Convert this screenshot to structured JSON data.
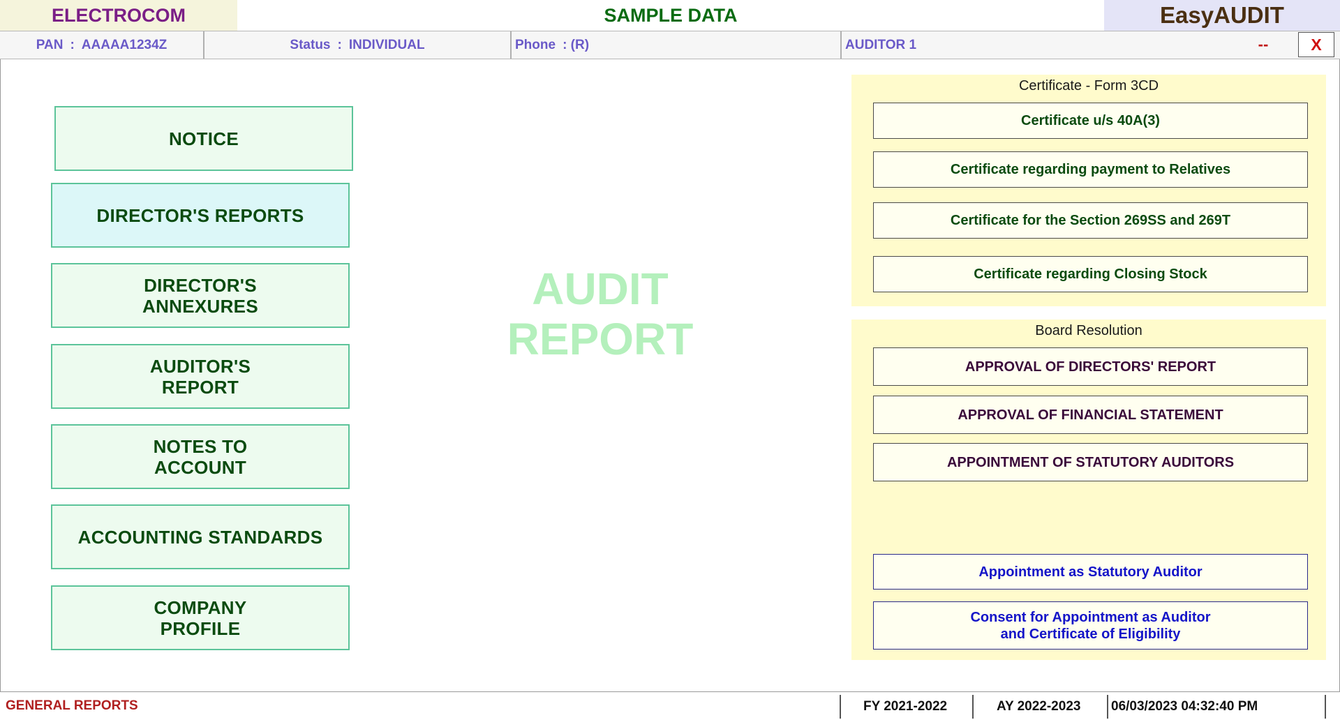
{
  "header": {
    "company": "ELECTROCOM",
    "dataset": "SAMPLE DATA",
    "app_name": "EasyAUDIT"
  },
  "info_bar": {
    "pan_label": "PAN",
    "pan_value": "AAAAA1234Z",
    "status_label": "Status",
    "status_value": "INDIVIDUAL",
    "phone_label": "Phone",
    "phone_value": ": (R)",
    "separator": ":",
    "auditor": "AUDITOR 1",
    "minimize_label": "--",
    "close_label": "X"
  },
  "left_menu": [
    {
      "label": "NOTICE"
    },
    {
      "label": "DIRECTOR'S REPORTS"
    },
    {
      "label": "DIRECTOR'S\nANNEXURES"
    },
    {
      "label": "AUDITOR'S\nREPORT"
    },
    {
      "label": "NOTES TO\nACCOUNT"
    },
    {
      "label": "ACCOUNTING STANDARDS"
    },
    {
      "label": "COMPANY\nPROFILE"
    }
  ],
  "watermark": {
    "line1": "AUDIT",
    "line2": "REPORT"
  },
  "certificate_panel": {
    "title": "Certificate - Form 3CD",
    "buttons": [
      "Certificate u/s 40A(3)",
      "Certificate regarding payment to Relatives",
      "Certificate for the Section 269SS and 269T",
      "Certificate regarding Closing Stock"
    ]
  },
  "board_panel": {
    "title": "Board Resolution",
    "buttons": [
      "APPROVAL OF DIRECTORS' REPORT",
      "APPROVAL OF FINANCIAL STATEMENT",
      "APPOINTMENT OF STATUTORY AUDITORS"
    ]
  },
  "appointment_panel": {
    "buttons": [
      "Appointment as Statutory Auditor",
      "Consent for Appointment as Auditor\nand Certificate of Eligibility"
    ]
  },
  "status_bar": {
    "module": "GENERAL REPORTS",
    "fy": "FY 2021-2022",
    "ay": "AY 2022-2023",
    "datetime": "06/03/2023 04:32:40 PM"
  },
  "colors": {
    "company_text": "#7a1e86",
    "dataset_text": "#0a6b12",
    "app_name_text": "#4a2f12",
    "info_text": "#6a5ac8",
    "close_text": "#d01010",
    "menu_text": "#0b4b10",
    "menu_bg": "#edfbef",
    "menu_border": "#5cc49a",
    "panel_bg": "#fffbcc",
    "appointment_text": "#1414c8",
    "module_text": "#b02020"
  }
}
